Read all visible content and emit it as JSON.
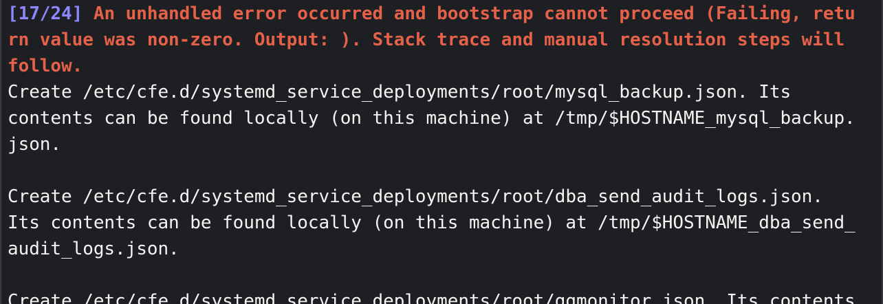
{
  "terminal": {
    "error": {
      "tag": "[17/24]",
      "line1": " An unhandled error occurred and bootstrap cannot proceed (Failing, retu",
      "line2": "rn value was non-zero. Output: ). Stack trace and manual resolution steps will",
      "line3": "follow."
    },
    "blocks": [
      {
        "line1": "Create /etc/cfe.d/systemd_service_deployments/root/mysql_backup.json. Its",
        "line2": "contents can be found locally (on this machine) at /tmp/$HOSTNAME_mysql_backup.",
        "line3": "json."
      },
      {
        "line1": "Create /etc/cfe.d/systemd_service_deployments/root/dba_send_audit_logs.json.",
        "line2": "Its contents can be found locally (on this machine) at /tmp/$HOSTNAME_dba_send_",
        "line3": "audit_logs.json."
      },
      {
        "line1": "Create /etc/cfe.d/systemd_service_deployments/root/ggmonitor.json. Its contents"
      }
    ]
  }
}
